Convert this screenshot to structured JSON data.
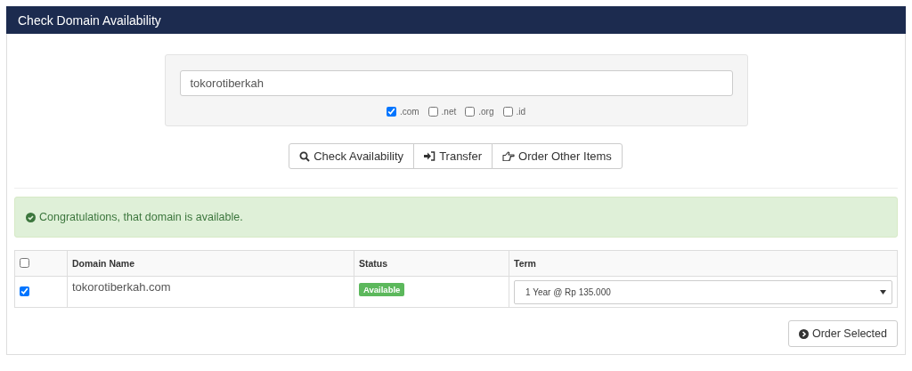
{
  "panel": {
    "title": "Check Domain Availability"
  },
  "search": {
    "value": "tokorotiberkah"
  },
  "tlds": [
    {
      "label": ".com",
      "checked": true
    },
    {
      "label": ".net",
      "checked": false
    },
    {
      "label": ".org",
      "checked": false
    },
    {
      "label": ".id",
      "checked": false
    }
  ],
  "actions": [
    {
      "kind": "search",
      "label": "Check Availability"
    },
    {
      "kind": "transfer",
      "label": "Transfer"
    },
    {
      "kind": "order",
      "label": "Order Other Items"
    }
  ],
  "alert": {
    "kind": "success",
    "text": "Congratulations, that domain is available."
  },
  "table": {
    "select_all": {
      "checked": false
    },
    "columns": [
      "Domain Name",
      "Status",
      "Term"
    ],
    "rows": [
      {
        "checked": true,
        "domain": "tokorotiberkah.com",
        "status": "Available",
        "term": "1 Year @ Rp 135.000"
      }
    ]
  },
  "submit": {
    "label": "Order Selected"
  }
}
